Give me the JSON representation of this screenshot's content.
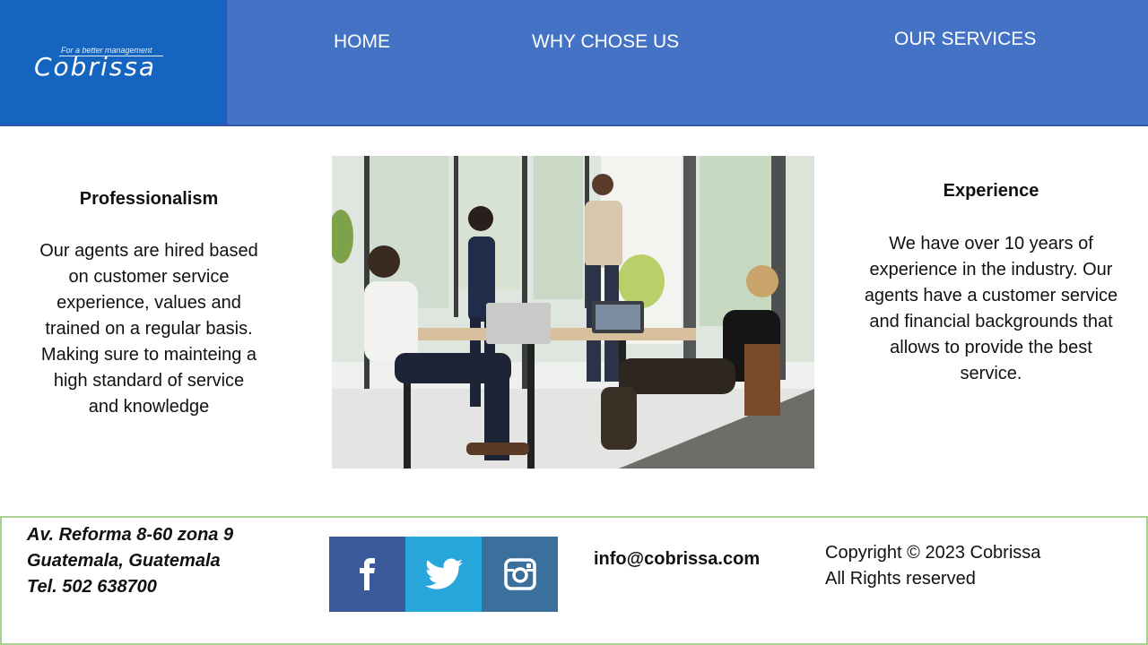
{
  "brand": {
    "tagline": "For a better management",
    "name": "Cobrissa"
  },
  "nav": {
    "home": "HOME",
    "why": "WHY CHOSE US",
    "services": "OUR SERVICES"
  },
  "main": {
    "left": {
      "title": "Professionalism",
      "lines": [
        "Our agents are hired based",
        "on customer service",
        "experience, values and",
        "trained on a regular basis.",
        "Making sure to mainteing a",
        "high standard of service",
        "and knowledge"
      ]
    },
    "right": {
      "title": "Experience",
      "lines": [
        "We have over 10 years of",
        "experience in the industry. Our",
        "agents have a customer service",
        "and financial backgrounds that",
        "allows to provide the best",
        "service."
      ]
    },
    "photo_icon": "office-team-photo"
  },
  "footer": {
    "address_lines": [
      "Av. Reforma 8-60 zona 9",
      "Guatemala, Guatemala",
      "Tel.  502 638700"
    ],
    "social": [
      {
        "icon": "facebook-icon",
        "color": "#3b5a9a"
      },
      {
        "icon": "twitter-icon",
        "color": "#27a6dc"
      },
      {
        "icon": "instagram-icon",
        "color": "#3b6f9c"
      }
    ],
    "email": "info@cobrissa.com",
    "copyright_lines": [
      "Copyright © 2023 Cobrissa",
      "All Rights reserved"
    ]
  },
  "colors": {
    "logo_bg": "#1565c0",
    "nav_bg": "#4472c4",
    "footer_border": "#a9d08e"
  }
}
